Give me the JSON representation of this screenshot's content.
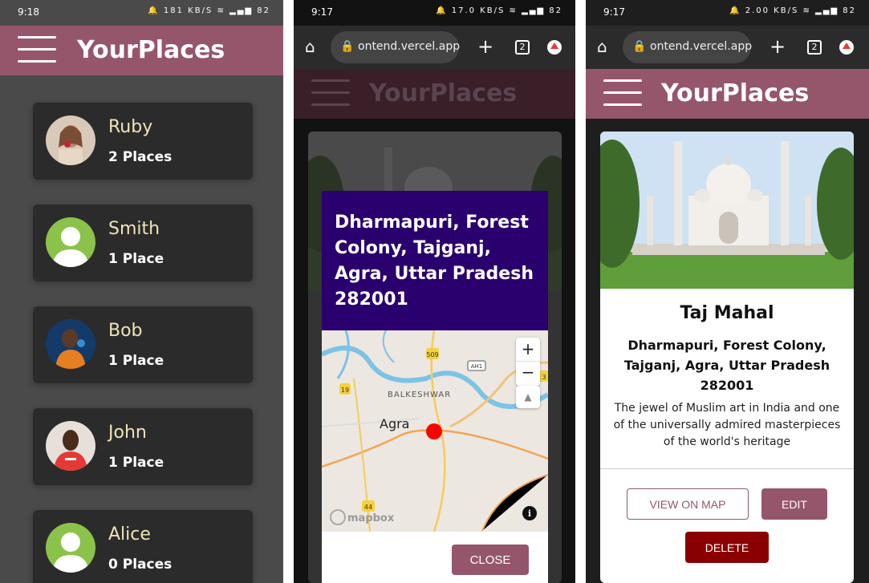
{
  "screens": [
    {
      "status_time": "9:18",
      "status_icons": "🔔 181 KB/S ≋ ▂▄▆ 82",
      "brand": "YourPlaces",
      "users": [
        {
          "name": "Ruby",
          "places": "2 Places"
        },
        {
          "name": "Smith",
          "places": "1 Place"
        },
        {
          "name": "Bob",
          "places": "1 Place"
        },
        {
          "name": "John",
          "places": "1 Place"
        },
        {
          "name": "Alice",
          "places": "0 Places"
        }
      ]
    },
    {
      "status_time": "9:17",
      "status_icons": "🔔 17.0 KB/S ≋ ▂▄▆ 82",
      "url": "ontend.vercel.app",
      "tab_count": "2",
      "brand": "YourPlaces",
      "modal": {
        "address": "Dharmapuri, Forest Colony, Tajganj, Agra, Uttar Pradesh 282001",
        "map_labels": {
          "city": "Agra",
          "area": "BALKESHWAR",
          "road_509": "509",
          "road_ah1": "AH1",
          "road_19": "19",
          "road_44": "44",
          "road_3": "3",
          "brand": "mapbox"
        },
        "close_label": "CLOSE"
      }
    },
    {
      "status_time": "9:17",
      "status_icons": "🔔 2.00 KB/S ≋ ▂▄▆ 82",
      "url": "ontend.vercel.app",
      "tab_count": "2",
      "brand": "YourPlaces",
      "place": {
        "title": "Taj Mahal",
        "address": "Dharmapuri, Forest Colony, Tajganj, Agra, Uttar Pradesh 282001",
        "description": "The jewel of Muslim art in India and one of the universally admired masterpieces of the world's heritage",
        "view_on_map_label": "VIEW ON MAP",
        "edit_label": "EDIT",
        "delete_label": "DELETE"
      }
    }
  ]
}
